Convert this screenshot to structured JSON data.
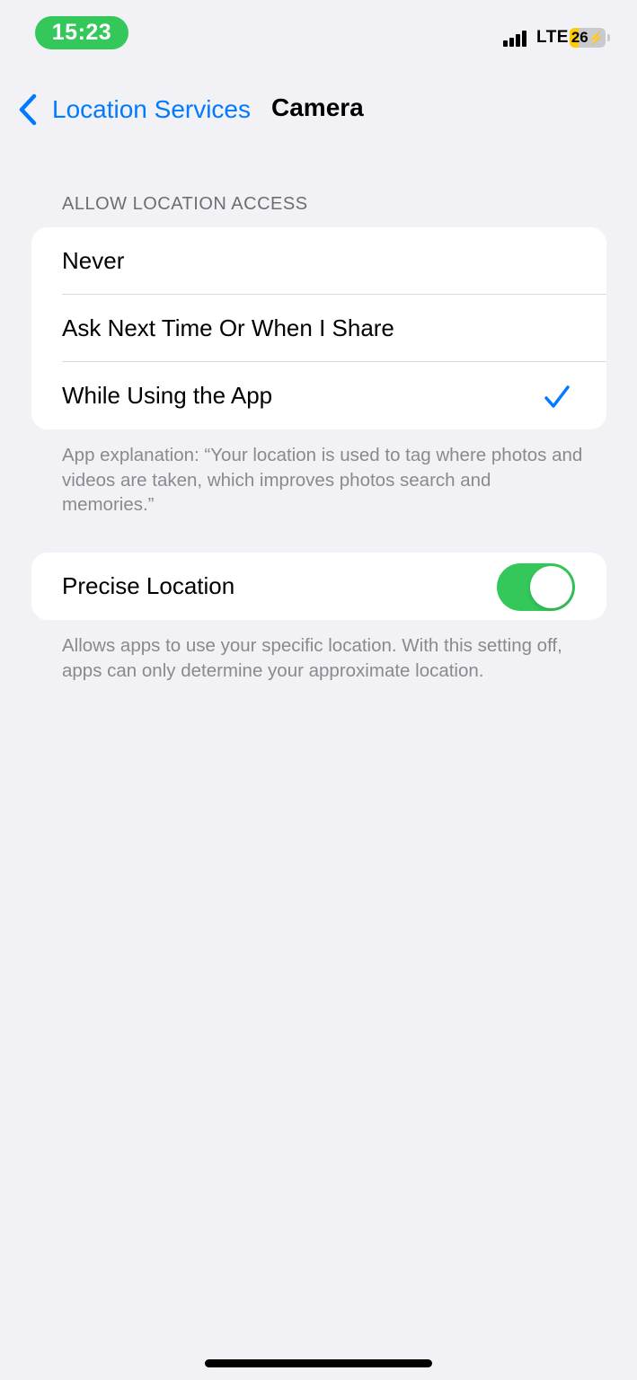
{
  "status_bar": {
    "time": "15:23",
    "network": "LTE",
    "battery_level": "26",
    "battery_fraction": 0.26,
    "battery_charging": true,
    "accent_color": "#34c759"
  },
  "nav": {
    "back_label": "Location Services",
    "title": "Camera",
    "back_icon": "chevron-left-icon",
    "tint": "#007aff"
  },
  "location_access": {
    "header": "ALLOW LOCATION ACCESS",
    "options": [
      {
        "label": "Never",
        "selected": false
      },
      {
        "label": "Ask Next Time Or When I Share",
        "selected": false
      },
      {
        "label": "While Using the App",
        "selected": true
      }
    ],
    "footer": "App explanation: “Your location is used to tag where photos and videos are taken, which improves photos search and memories.”"
  },
  "precise_location": {
    "label": "Precise Location",
    "enabled": true,
    "toggle_color": "#34c759",
    "footer": "Allows apps to use your specific location. With this setting off, apps can only determine your approximate location."
  }
}
